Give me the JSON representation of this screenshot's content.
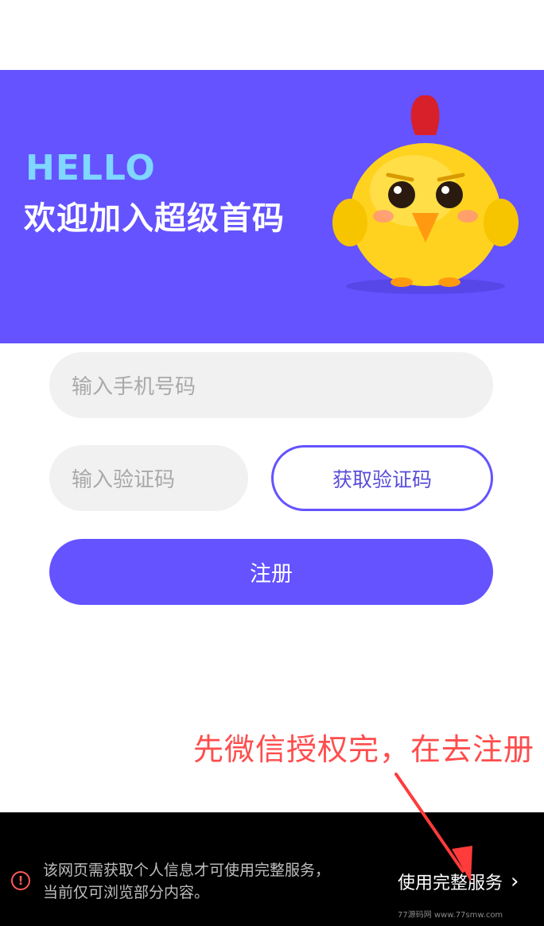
{
  "banner": {
    "hello": "HELLO",
    "welcome": "欢迎加入超级首码",
    "mascot_icon": "chick-mascot-icon",
    "background": "#6453ff"
  },
  "form": {
    "phone_placeholder": "输入手机号码",
    "code_placeholder": "输入验证码",
    "get_code_label": "获取验证码",
    "register_label": "注册",
    "accent": "#6453ff"
  },
  "annotation": {
    "text": "先微信授权完，在去注册",
    "color": "#ff4d4d"
  },
  "bottom_bar": {
    "notice": "该网页需获取个人信息才可使用完整服务，当前仅可浏览部分内容。",
    "full_service_label": "使用完整服务",
    "chevron": "›",
    "watermark": "77源码网  www.77smw.com"
  }
}
